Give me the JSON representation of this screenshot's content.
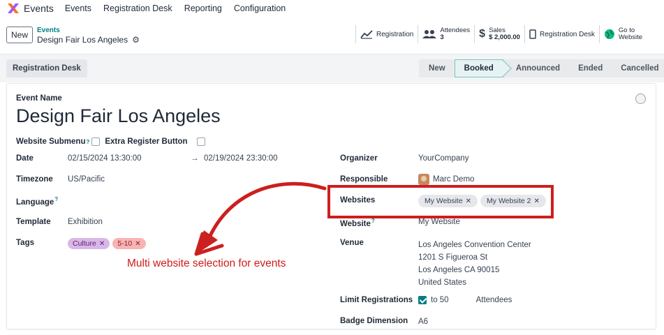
{
  "navbar": {
    "app_name": "Events",
    "menu": [
      "Events",
      "Registration Desk",
      "Reporting",
      "Configuration"
    ]
  },
  "control": {
    "new_label": "New",
    "breadcrumb_parent": "Events",
    "breadcrumb_current": "Design Fair Los Angeles",
    "smart_buttons": {
      "registration": "Registration",
      "attendees_label": "Attendees",
      "attendees_value": "3",
      "sales_label": "Sales",
      "sales_value": "$ 2,000.00",
      "registration_desk": "Registration Desk",
      "website_line1": "Go to",
      "website_line2": "Website"
    }
  },
  "statusrow": {
    "regdesk_label": "Registration Desk",
    "stages": [
      "New",
      "Booked",
      "Announced",
      "Ended",
      "Cancelled"
    ],
    "active_stage": "Booked"
  },
  "form": {
    "event_name_label": "Event Name",
    "event_name": "Design Fair Los Angeles",
    "website_submenu_label": "Website Submenu",
    "extra_register_label": "Extra Register Button",
    "date_label": "Date",
    "date_start": "02/15/2024 13:30:00",
    "date_end": "02/19/2024 23:30:00",
    "date_arrow": "→",
    "timezone_label": "Timezone",
    "timezone": "US/Pacific",
    "language_label": "Language",
    "template_label": "Template",
    "template": "Exhibition",
    "tags_label": "Tags",
    "tags": [
      "Culture",
      "5-10"
    ],
    "organizer_label": "Organizer",
    "organizer": "YourCompany",
    "responsible_label": "Responsible",
    "responsible": "Marc Demo",
    "websites_label": "Websites",
    "websites": [
      "My Website",
      "My Website 2"
    ],
    "website_label": "Website",
    "website": "My Website",
    "venue_label": "Venue",
    "venue_lines": [
      "Los Angeles Convention Center",
      "1201 S Figueroa St",
      "Los Angeles CA 90015",
      "United States"
    ],
    "limit_label": "Limit Registrations",
    "limit_to": "to 50",
    "limit_unit": "Attendees",
    "badge_label": "Badge Dimension",
    "badge": "A6"
  },
  "annotation": {
    "text": "Multi website selection for events"
  },
  "colors": {
    "accent": "#017e84",
    "annotation_red": "#cc1f1f",
    "tag_culture": "#d9b8e8",
    "tag_size": "#f8b4b4"
  }
}
